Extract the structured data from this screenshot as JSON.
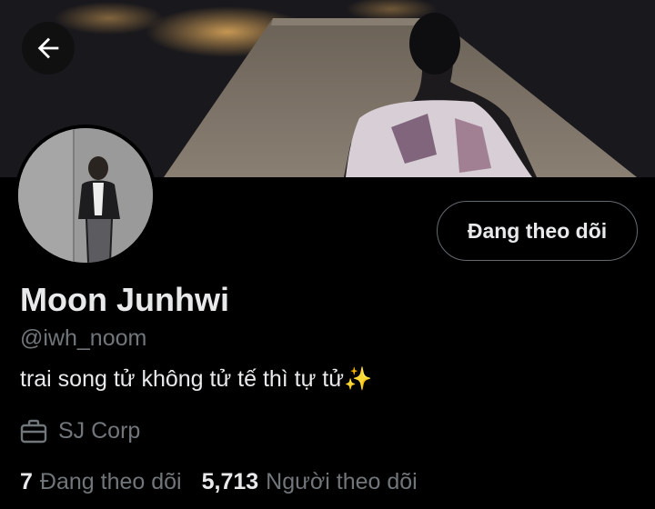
{
  "header": {
    "back_icon": "arrow-left-icon",
    "banner": "banner-photo"
  },
  "profile": {
    "avatar": "avatar-photo",
    "follow_button_label": "Đang theo dõi",
    "display_name": "Moon Junhwi",
    "handle": "@iwh_noom",
    "bio": "trai song tử không tử tế thì tự tử✨",
    "work_icon": "briefcase-icon",
    "work": "SJ Corp",
    "following_count": "7",
    "following_label": "Đang theo dõi",
    "followers_count": "5,713",
    "followers_label": "Người theo dõi"
  },
  "colors": {
    "background": "#000000",
    "text_primary": "#e7e9ea",
    "text_secondary": "#71767b",
    "button_border": "#636a70"
  }
}
